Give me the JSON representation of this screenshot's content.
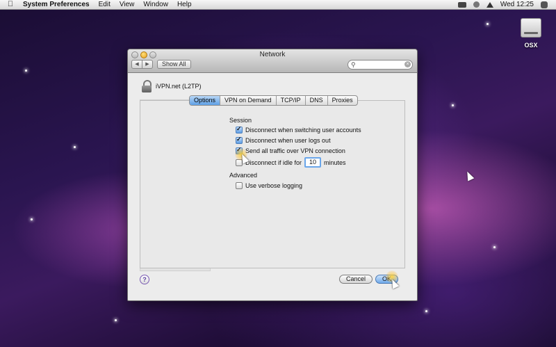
{
  "menubar": {
    "app_name": "System Preferences",
    "menus": [
      "Edit",
      "View",
      "Window",
      "Help"
    ],
    "clock": "Wed 12:25",
    "status_icons": [
      "battery-icon",
      "time-machine-icon",
      "eject-icon",
      "spotlight-icon"
    ]
  },
  "desktop": {
    "disk_label": "OSX"
  },
  "window": {
    "title": "Network",
    "show_all": "Show All",
    "search": {
      "value": "",
      "placeholder": ""
    }
  },
  "service": {
    "name": "iVPN.net (L2TP)"
  },
  "tabs": [
    {
      "label": "Options",
      "selected": true
    },
    {
      "label": "VPN on Demand",
      "selected": false
    },
    {
      "label": "TCP/IP",
      "selected": false
    },
    {
      "label": "DNS",
      "selected": false
    },
    {
      "label": "Proxies",
      "selected": false
    }
  ],
  "session": {
    "title": "Session",
    "options": [
      {
        "label": "Disconnect when switching user accounts",
        "checked": true
      },
      {
        "label": "Disconnect when user logs out",
        "checked": true
      },
      {
        "label": "Send all traffic over VPN connection",
        "checked": true
      }
    ],
    "idle": {
      "prefix": "Disconnect if idle for",
      "value": "10",
      "suffix": "minutes",
      "checked": false
    }
  },
  "advanced": {
    "title": "Advanced",
    "verbose": {
      "label": "Use verbose logging",
      "checked": false
    }
  },
  "buttons": {
    "help": "?",
    "cancel": "Cancel",
    "ok": "OK"
  }
}
